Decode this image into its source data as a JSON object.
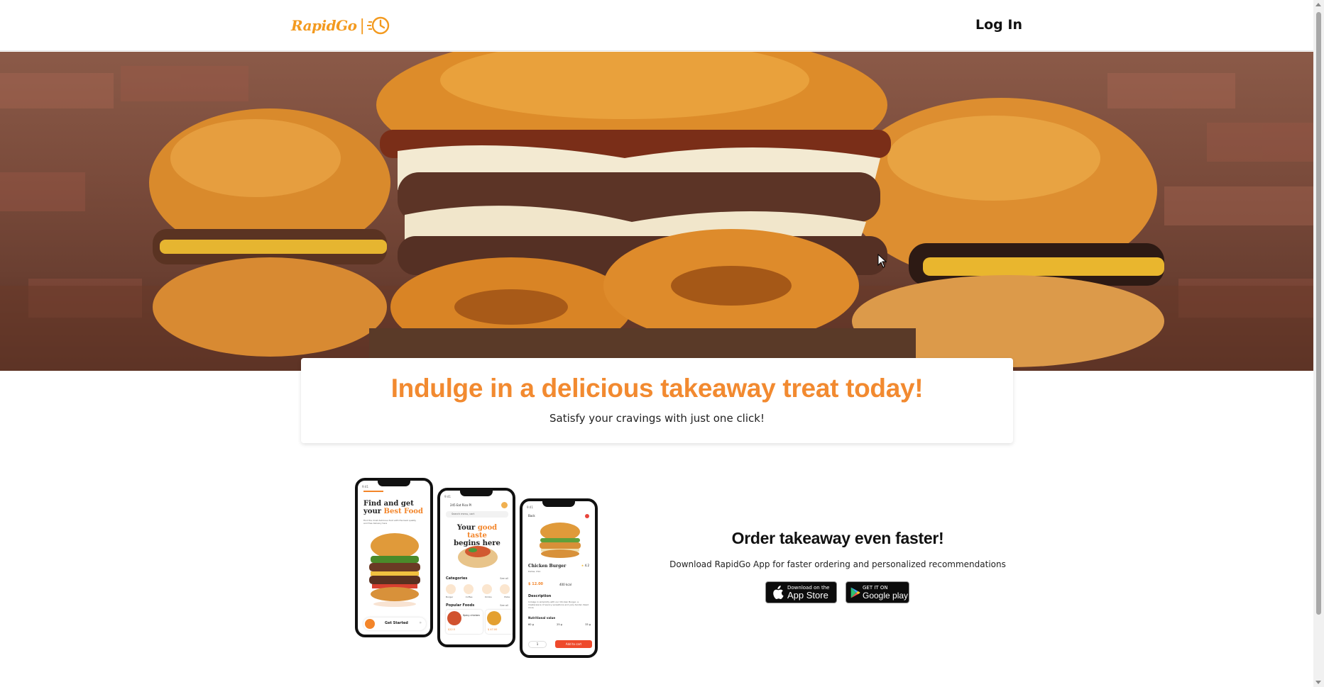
{
  "header": {
    "logo_text": "RapidGo",
    "logo_separator": "|",
    "logo_icon": "stopwatch-icon",
    "login_label": "Log In"
  },
  "hero": {
    "image": "burger-hero-image"
  },
  "card": {
    "headline": "Indulge in a delicious takeaway treat today!",
    "subline": "Satisfy your cravings with just one click!"
  },
  "promo": {
    "title": "Order takeaway even faster!",
    "text": "Download RapidGo App for faster ordering and personalized recommendations",
    "appstore_small": "Download on the",
    "appstore_big": "App Store",
    "gplay_small": "GET IT ON",
    "gplay_big": "Google play"
  },
  "phones": {
    "p1": {
      "status": "9:41",
      "title_a": "Find and get",
      "title_b": "your ",
      "title_c": "Best Food",
      "desc": "Find the most delicious food with the best quality and free delivery here",
      "button": "Get Started"
    },
    "p2": {
      "status": "9:41",
      "location": "245 Eat Rico Pl",
      "search": "Search menu, cart",
      "title_a": "Your ",
      "title_b": "good taste",
      "title_c": "begins here",
      "categories": "Categories",
      "see_all": "See all",
      "cat_items": [
        "Burger",
        "Coffee",
        "Drinks",
        "Pizza"
      ],
      "popular": "Popular Foods",
      "popular_more": "See all",
      "food_a": "Spicy chicken",
      "price_a": "$12.5",
      "price_b": "$ 47.00"
    },
    "p3": {
      "status": "9:41",
      "back": "Back",
      "name": "Chicken Burger",
      "rating": "4.2",
      "location": "Dallas, USA",
      "price": "$ 12.00",
      "calories": "400 kcal",
      "desc_title": "Description",
      "desc": "Indulge in simplicity with our Chicken Burger, a masterpiece of savory sensations and juicy tender. Read more",
      "nutri_title": "Nutritional value",
      "nutri": [
        "60 g",
        "25 g",
        "33 g"
      ],
      "qty": "1",
      "cta": "Add to cart"
    }
  }
}
